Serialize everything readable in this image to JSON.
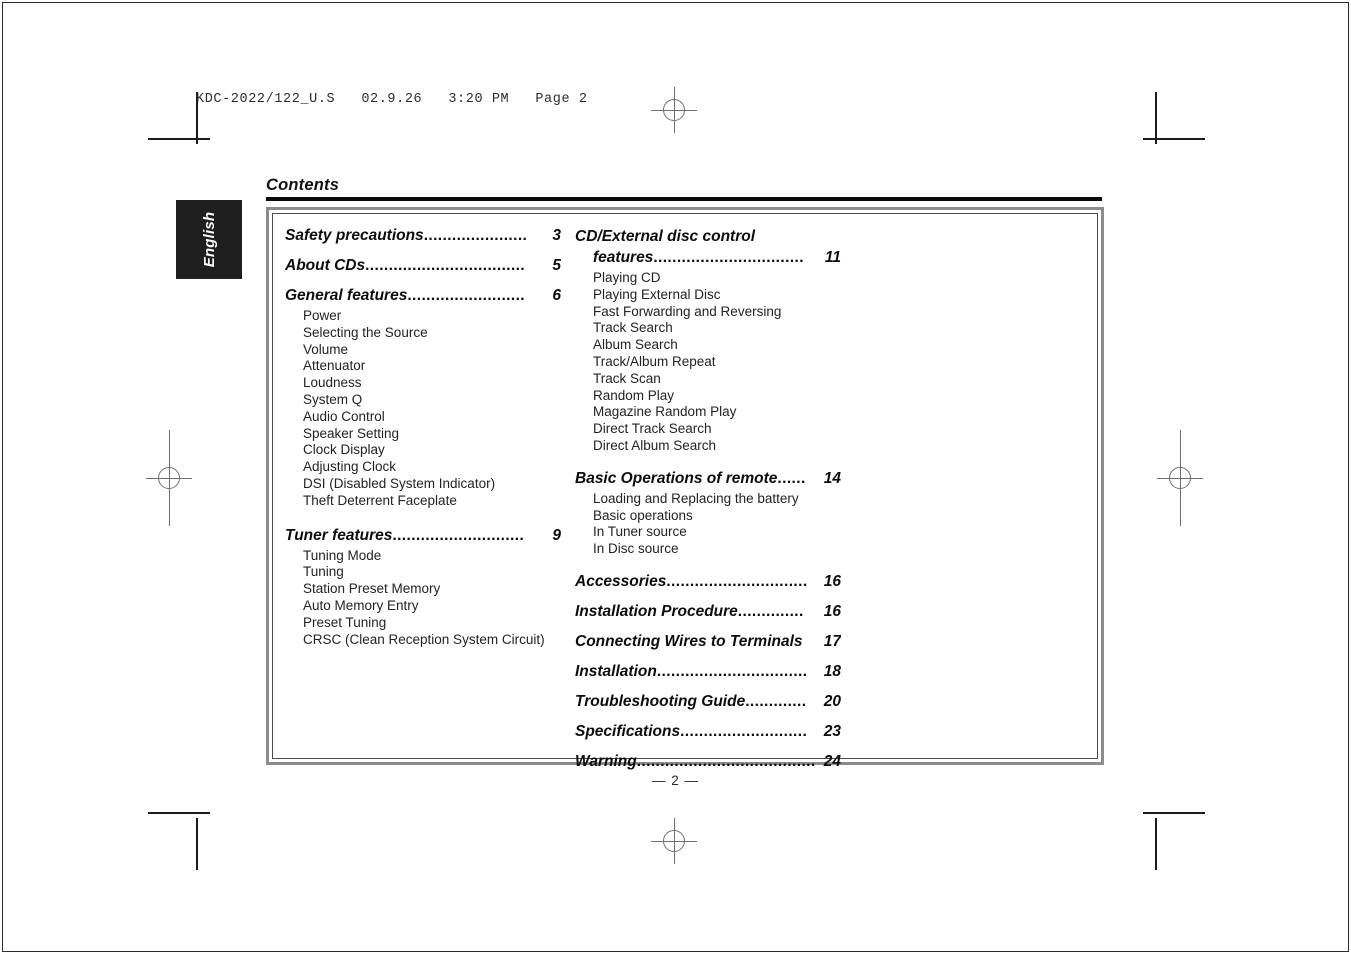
{
  "proof_header": "KDC-2022/122_U.S   02.9.26   3:20 PM   Page 2",
  "page_number": "— 2 —",
  "language_tab": "English",
  "title": "Contents",
  "colors": {
    "tab_background": "#1f1f1f",
    "tab_text": "#ffffff",
    "rule": "#0a0a0a",
    "box_border_outer": "#8c8c8c",
    "box_border_inner": "#4a4a4a",
    "text": "#0d0d0d",
    "subtext": "#232323",
    "registration_mark": "#6e6e6e"
  },
  "toc": {
    "left_column": [
      {
        "label": "Safety precautions",
        "page": "3",
        "leader": "......................",
        "sub": []
      },
      {
        "label": "About CDs",
        "page": "5",
        "leader": "..................................",
        "sub": []
      },
      {
        "label": "General features ",
        "page": "6",
        "leader": ".........................",
        "sub": [
          "Power",
          "Selecting the Source",
          "Volume",
          "Attenuator",
          "Loudness",
          "System Q",
          "Audio Control",
          "Speaker Setting",
          "Clock Display",
          "Adjusting Clock",
          "DSI (Disabled System Indicator)",
          "Theft Deterrent Faceplate"
        ]
      },
      {
        "label": "Tuner features ",
        "page": "9",
        "leader": "............................",
        "sub": [
          "Tuning Mode",
          "Tuning",
          "Station Preset Memory",
          "Auto Memory Entry",
          "Preset Tuning",
          "CRSC (Clean Reception System Circuit)"
        ]
      }
    ],
    "right_column": [
      {
        "label_line1": "CD/External disc control",
        "label_line2": "features ",
        "page": "11",
        "leader": "................................",
        "wrapped": true,
        "sub": [
          "Playing CD",
          "Playing External Disc",
          "Fast Forwarding and Reversing",
          "Track Search",
          "Album Search",
          "Track/Album Repeat",
          "Track Scan",
          "Random Play",
          "Magazine Random Play",
          "Direct Track Search",
          "Direct Album Search"
        ]
      },
      {
        "label": "Basic Operations of remote",
        "page": "14",
        "leader": "......",
        "sub": [
          "Loading and Replacing the battery",
          "Basic operations",
          "In Tuner source",
          "In Disc source"
        ]
      },
      {
        "label": "Accessories ",
        "page": "16",
        "leader": "..............................",
        "sub": []
      },
      {
        "label": "Installation Procedure ",
        "page": "16",
        "leader": "..............",
        "sub": []
      },
      {
        "label": "Connecting Wires to Terminals",
        "page": "17",
        "leader": "",
        "no_leader": true,
        "sub": []
      },
      {
        "label": "Installation ",
        "page": "18",
        "leader": "................................",
        "sub": []
      },
      {
        "label": "Troubleshooting Guide ",
        "page": "20",
        "leader": ".............",
        "sub": []
      },
      {
        "label": "Specifications ",
        "page": "23",
        "leader": "...........................",
        "sub": []
      },
      {
        "label": "Warning ",
        "page": "24",
        "leader": "......................................",
        "sub": []
      }
    ]
  }
}
